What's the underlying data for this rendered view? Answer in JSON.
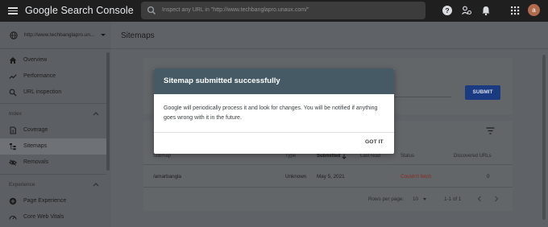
{
  "app": {
    "brand": "Google Search Console"
  },
  "search": {
    "placeholder": "Inspect any URL in \"http://www.techbanglapro.unaux.com/\""
  },
  "topbar_icons": [
    "help-icon",
    "manage-users-icon",
    "notifications-icon",
    "apps-grid-icon"
  ],
  "user": {
    "avatar_letter": "a"
  },
  "property": {
    "url": "http://www.techbanglapro.un..."
  },
  "sidebar": {
    "items": [
      {
        "label": "Overview",
        "icon": "home-icon"
      },
      {
        "label": "Performance",
        "icon": "trending-icon"
      },
      {
        "label": "URL inspection",
        "icon": "search-icon"
      }
    ],
    "index_heading": "Index",
    "index_items": [
      {
        "label": "Coverage",
        "icon": "coverage-icon"
      },
      {
        "label": "Sitemaps",
        "icon": "sitemap-icon",
        "active": true
      },
      {
        "label": "Removals",
        "icon": "removals-icon"
      }
    ],
    "experience_heading": "Experience",
    "experience_items": [
      {
        "label": "Page Experience",
        "icon": "plus-circle-icon"
      },
      {
        "label": "Core Web Vitals",
        "icon": "speed-icon"
      }
    ]
  },
  "page": {
    "title": "Sitemaps"
  },
  "submit_card": {
    "submit_label": "SUBMIT"
  },
  "table": {
    "headers": {
      "sitemap": "Sitemap",
      "type": "Type",
      "submitted": "Submitted",
      "last_read": "Last read",
      "status": "Status",
      "discovered": "Discovered URLs"
    },
    "rows": [
      {
        "sitemap": "/amarbangla",
        "type": "Unknown",
        "submitted": "May 5, 2021",
        "last_read": "",
        "status": "Couldn't fetch",
        "discovered": "0"
      }
    ],
    "footer": {
      "rows_per_page_label": "Rows per page:",
      "rows_per_page": "10",
      "range": "1-1 of 1"
    }
  },
  "dialog": {
    "title": "Sitemap submitted successfully",
    "body": "Google will periodically process it and look for changes. You will be notified if anything goes wrong with it in the future.",
    "button": "GOT IT"
  },
  "colors": {
    "dialog_header": "#455a64",
    "submit_button": "#1a3b82",
    "status_error": "#8a2a22",
    "topbar": "#1f1f1f"
  }
}
